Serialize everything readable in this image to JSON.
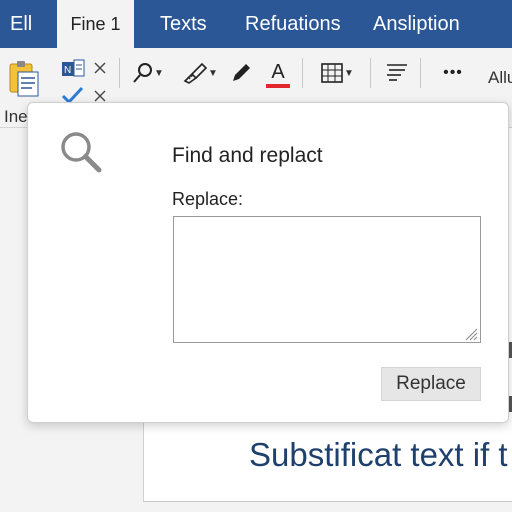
{
  "tabs": [
    {
      "label": "Ell",
      "active": false
    },
    {
      "label": "Fine 1",
      "active": true
    },
    {
      "label": "Texts",
      "active": false
    },
    {
      "label": "Refuations",
      "active": false
    },
    {
      "label": "Ansliption",
      "active": false
    }
  ],
  "ribbon": {
    "left_label": "Ine",
    "right_label": "Allu",
    "icons": [
      "clipboard-icon",
      "format-painter-icon",
      "check-icon",
      "close-icon",
      "search-icon",
      "highlighter-icon",
      "pen-icon",
      "font-color-icon",
      "table-icon",
      "paragraph-icon",
      "more-icon"
    ],
    "font_color_letter": "A",
    "font_color_accent": "#e0282e",
    "more_glyph": "•••"
  },
  "dialog": {
    "title": "Find and replact",
    "replace_label": "Replace:",
    "replace_value": "",
    "button_label": "Replace",
    "icon": "magnifier-icon"
  },
  "document": {
    "text": "Substificat text if t"
  },
  "colors": {
    "tab_bar": "#2b5797",
    "document_text": "#1f3f6d"
  }
}
